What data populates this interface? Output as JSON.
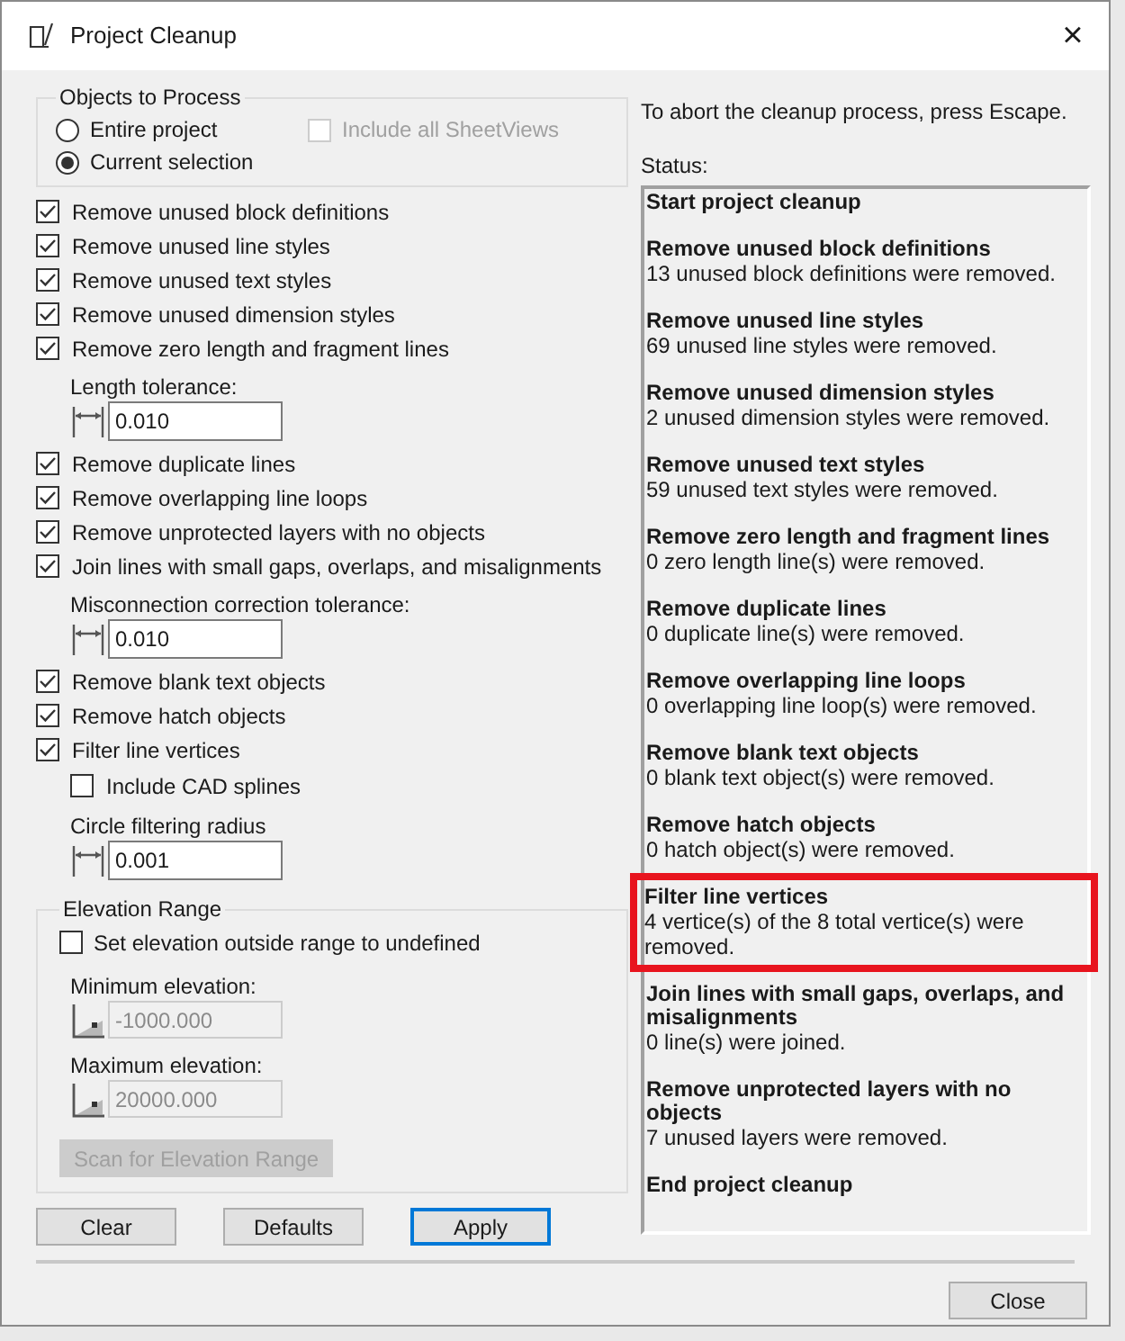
{
  "window": {
    "title": "Project Cleanup",
    "close": "×"
  },
  "objects_group": {
    "title": "Objects to Process",
    "scope": [
      {
        "label": "Entire project",
        "selected": false
      },
      {
        "label": "Current selection",
        "selected": true
      }
    ],
    "sheetviews": {
      "label": "Include all SheetViews",
      "checked": false,
      "disabled": true
    }
  },
  "options": [
    {
      "kind": "checkbox",
      "label": "Remove unused block definitions",
      "checked": true
    },
    {
      "kind": "checkbox",
      "label": "Remove unused line styles",
      "checked": true
    },
    {
      "kind": "checkbox",
      "label": "Remove unused text styles",
      "checked": true
    },
    {
      "kind": "checkbox",
      "label": "Remove unused dimension styles",
      "checked": true
    },
    {
      "kind": "checkbox",
      "label": "Remove zero length and fragment lines",
      "checked": true,
      "children": [
        {
          "kind": "field",
          "label": "Length tolerance:",
          "value": "0.010"
        }
      ]
    },
    {
      "kind": "checkbox",
      "label": "Remove duplicate lines",
      "checked": true
    },
    {
      "kind": "checkbox",
      "label": "Remove overlapping line loops",
      "checked": true
    },
    {
      "kind": "checkbox",
      "label": "Remove unprotected layers with no objects",
      "checked": true
    },
    {
      "kind": "checkbox",
      "label": "Join lines with small gaps, overlaps, and misalignments",
      "checked": true,
      "children": [
        {
          "kind": "field",
          "label": "Misconnection correction tolerance:",
          "value": "0.010"
        }
      ]
    },
    {
      "kind": "checkbox",
      "label": "Remove blank text objects",
      "checked": true
    },
    {
      "kind": "checkbox",
      "label": "Remove hatch objects",
      "checked": true
    },
    {
      "kind": "checkbox",
      "label": "Filter line vertices",
      "checked": true,
      "children": [
        {
          "kind": "checkbox",
          "label": "Include CAD splines",
          "checked": false
        },
        {
          "kind": "field",
          "label": "Circle filtering radius",
          "value": "0.001"
        }
      ]
    }
  ],
  "elevation": {
    "title": "Elevation Range",
    "undefined_option": {
      "label": "Set elevation outside range to undefined",
      "checked": false
    },
    "fields": [
      {
        "label": "Minimum elevation:",
        "value": "-1000.000",
        "disabled": true
      },
      {
        "label": "Maximum elevation:",
        "value": "20000.000",
        "disabled": true
      }
    ],
    "scan_button": {
      "label": "Scan for Elevation Range",
      "disabled": true
    }
  },
  "buttons": [
    {
      "label": "Clear",
      "default": false
    },
    {
      "label": "Defaults",
      "default": false
    },
    {
      "label": "Apply",
      "default": true
    }
  ],
  "abort_hint": "To abort the cleanup process, press Escape.",
  "status_label": "Status:",
  "status_log": [
    {
      "title": "Start project cleanup",
      "highlighted": false
    },
    {
      "title": "Remove unused block definitions",
      "detail": "13 unused block definitions were removed.",
      "highlighted": false
    },
    {
      "title": "Remove unused line styles",
      "detail": "69 unused line styles were removed.",
      "highlighted": false
    },
    {
      "title": "Remove unused dimension styles",
      "detail": "2 unused dimension styles were removed.",
      "highlighted": false
    },
    {
      "title": "Remove unused text styles",
      "detail": "59 unused text styles were removed.",
      "highlighted": false
    },
    {
      "title": "Remove zero length and fragment lines",
      "detail": "0 zero length line(s) were removed.",
      "highlighted": false
    },
    {
      "title": "Remove duplicate lines",
      "detail": "0 duplicate line(s) were removed.",
      "highlighted": false
    },
    {
      "title": "Remove overlapping line loops",
      "detail": "0 overlapping line loop(s) were removed.",
      "highlighted": false
    },
    {
      "title": "Remove blank text objects",
      "detail": "0 blank text object(s) were removed.",
      "highlighted": false
    },
    {
      "title": "Remove hatch objects",
      "detail": "0 hatch object(s) were removed.",
      "highlighted": false
    },
    {
      "title": "Filter line vertices",
      "detail": "4 vertice(s) of the 8 total vertice(s) were removed.",
      "highlighted": true
    },
    {
      "title": "Join lines with small gaps, overlaps, and misalignments",
      "detail": "0 line(s) were joined.",
      "highlighted": false
    },
    {
      "title": "Remove unprotected layers with no objects",
      "detail": "7 unused layers were removed.",
      "highlighted": false
    },
    {
      "title": "End project cleanup",
      "highlighted": false
    }
  ],
  "close_button": "Close"
}
